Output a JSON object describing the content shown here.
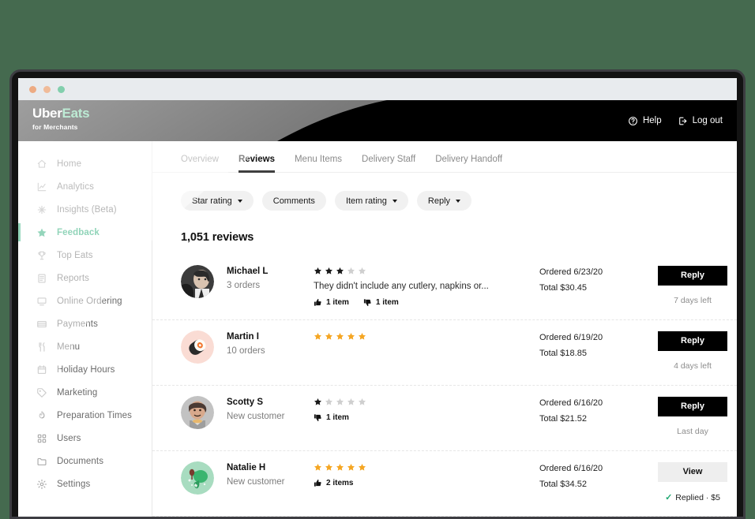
{
  "window": {
    "dots": [
      "close-dot",
      "minimize-dot",
      "maximize-dot"
    ]
  },
  "colors": {
    "page_bg": "#456a4f",
    "header_bg": "#000000",
    "brand_green": "#5fcf98",
    "active_green": "#1fa871",
    "star_gold": "#f5a623",
    "star_dark": "#1a1a1a",
    "star_empty": "#cfcfcf",
    "primary_button": "#000000",
    "secondary_button": "#eeeeee"
  },
  "header": {
    "brand_uber": "Uber",
    "brand_eats": "Eats",
    "brand_sub": "for Merchants",
    "help_label": "Help",
    "logout_label": "Log out"
  },
  "sidebar": {
    "items": [
      {
        "label": "Home",
        "icon": "home-icon",
        "active": false
      },
      {
        "label": "Analytics",
        "icon": "analytics-icon",
        "active": false
      },
      {
        "label": "Insights (Beta)",
        "icon": "insights-icon",
        "active": false
      },
      {
        "label": "Feedback",
        "icon": "star-icon",
        "active": true
      },
      {
        "label": "Top Eats",
        "icon": "trophy-icon",
        "active": false
      },
      {
        "label": "Reports",
        "icon": "reports-icon",
        "active": false
      },
      {
        "label": "Online Ordering",
        "icon": "monitor-icon",
        "active": false
      },
      {
        "label": "Payments",
        "icon": "payments-icon",
        "active": false
      },
      {
        "label": "Menu",
        "icon": "cutlery-icon",
        "active": false
      },
      {
        "label": "Holiday Hours",
        "icon": "calendar-icon",
        "active": false
      },
      {
        "label": "Marketing",
        "icon": "tag-icon",
        "active": false
      },
      {
        "label": "Preparation Times",
        "icon": "flame-icon",
        "active": false
      },
      {
        "label": "Users",
        "icon": "users-icon",
        "active": false
      },
      {
        "label": "Documents",
        "icon": "folder-icon",
        "active": false
      },
      {
        "label": "Settings",
        "icon": "gear-icon",
        "active": false
      }
    ]
  },
  "main": {
    "tabs": [
      {
        "label": "Overview",
        "active": false
      },
      {
        "label": "Reviews",
        "active": true
      },
      {
        "label": "Menu Items",
        "active": false
      },
      {
        "label": "Delivery Staff",
        "active": false
      },
      {
        "label": "Delivery Handoff",
        "active": false
      }
    ],
    "filters": [
      {
        "label": "Star rating",
        "has_chevron": true
      },
      {
        "label": "Comments",
        "has_chevron": false
      },
      {
        "label": "Item rating",
        "has_chevron": true
      },
      {
        "label": "Reply",
        "has_chevron": true
      }
    ],
    "reviews_count": "1,051 reviews",
    "reviews": [
      {
        "avatar": "photo-avatar-michael",
        "avatar_bg": "#d9d9d9",
        "name": "Michael L",
        "orders": "3 orders",
        "rating": 3,
        "star_style": "dark",
        "comment": "They didn't include any cutlery, napkins or...",
        "items": [
          {
            "type": "thumbs-up",
            "label": "1 item"
          },
          {
            "type": "thumbs-down",
            "label": "1 item"
          }
        ],
        "ordered": "Ordered 6/23/20",
        "total": "Total $30.45",
        "action_label": "Reply",
        "action_style": "primary",
        "note": "7 days left",
        "note_replied": false
      },
      {
        "avatar": "sushi-avatar-martin",
        "avatar_bg": "#fadcd4",
        "name": "Martin I",
        "orders": "10 orders",
        "rating": 5,
        "star_style": "gold",
        "comment": "",
        "items": [],
        "ordered": "Ordered 6/19/20",
        "total": "Total $18.85",
        "action_label": "Reply",
        "action_style": "primary",
        "note": "4 days left",
        "note_replied": false
      },
      {
        "avatar": "photo-avatar-scotty",
        "avatar_bg": "#c9c9c9",
        "name": "Scotty S",
        "orders": "New customer",
        "rating": 1,
        "star_style": "dark",
        "comment": "",
        "items": [
          {
            "type": "thumbs-down",
            "label": "1 item"
          }
        ],
        "ordered": "Ordered 6/16/20",
        "total": "Total $21.52",
        "action_label": "Reply",
        "action_style": "primary",
        "note": "Last day",
        "note_replied": false
      },
      {
        "avatar": "broccoli-avatar-natalie",
        "avatar_bg": "#a8dcc0",
        "name": "Natalie H",
        "orders": "New customer",
        "rating": 5,
        "star_style": "gold",
        "comment": "",
        "items": [
          {
            "type": "thumbs-up",
            "label": "2 items"
          }
        ],
        "ordered": "Ordered 6/16/20",
        "total": "Total $34.52",
        "action_label": "View",
        "action_style": "secondary",
        "note": "Replied · $5",
        "note_replied": true
      }
    ]
  }
}
